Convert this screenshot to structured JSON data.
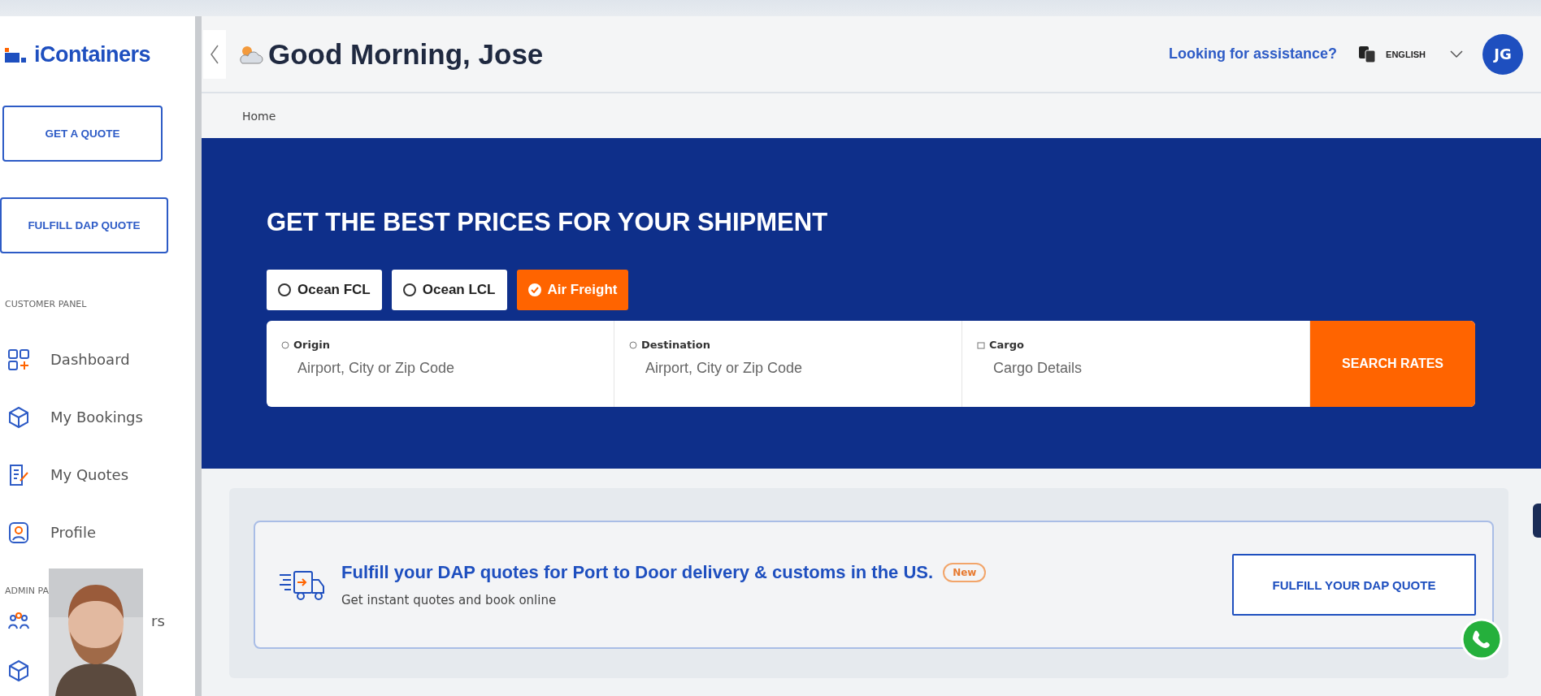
{
  "sidebar": {
    "logo": "iContainers",
    "buttons": [
      "GET A QUOTE",
      "FULFILL DAP QUOTE"
    ],
    "customer_heading": "CUSTOMER PANEL",
    "items": [
      {
        "kind": "dashboard",
        "label": "Dashboard",
        "selected": false
      },
      {
        "kind": "bookings",
        "label": "My Bookings",
        "selected": false
      },
      {
        "kind": "quotes",
        "label": "My Quotes",
        "selected": false
      },
      {
        "kind": "profile",
        "label": "Profile",
        "selected": false
      }
    ],
    "admin_heading": "ADMIN PA",
    "admin_items": [
      {
        "kind": "users",
        "label": "rs"
      },
      {
        "kind": "bookings"
      }
    ]
  },
  "header": {
    "greeting": "Good Morning, Jose",
    "assistance_link": "Looking for assistance?",
    "language": "ENGLISH",
    "avatar": "JG"
  },
  "breadcrumb": "Home",
  "hero": {
    "title": "GET THE BEST PRICES FOR YOUR SHIPMENT",
    "modes": [
      {
        "label": "Ocean FCL",
        "selected": false
      },
      {
        "label": "Ocean LCL",
        "selected": false
      },
      {
        "label": "Air Freight",
        "selected": true
      }
    ],
    "fields": [
      {
        "kind": "location",
        "label": "Origin",
        "placeholder": "Airport, City or Zip Code"
      },
      {
        "kind": "location",
        "label": "Destination",
        "placeholder": "Airport, City or Zip Code"
      },
      {
        "kind": "cargo",
        "label": "Cargo",
        "placeholder": "Cargo Details"
      }
    ],
    "search_button": "SEARCH RATES"
  },
  "promo": {
    "title": "Fulfill your DAP quotes for Port to Door delivery & customs in the US.",
    "badge": "New",
    "subtitle": "Get instant quotes and book online",
    "button": "FULFILL YOUR DAP QUOTE"
  }
}
